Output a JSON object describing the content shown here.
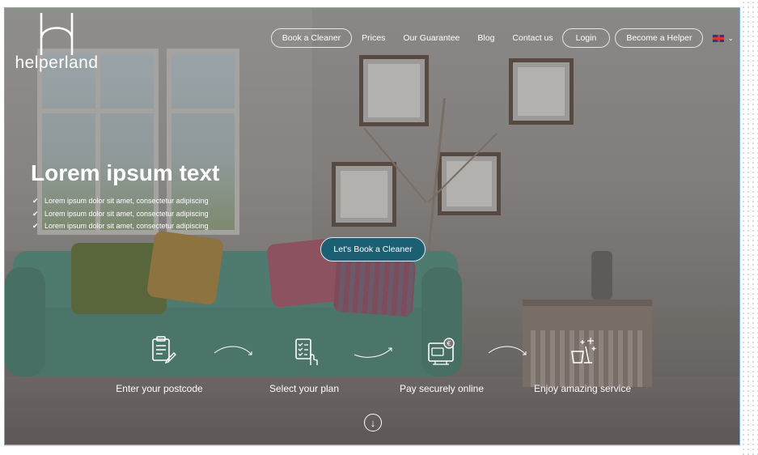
{
  "brand": {
    "name": "helperland"
  },
  "nav": {
    "book": "Book a Cleaner",
    "prices": "Prices",
    "guarantee": "Our Guarantee",
    "blog": "Blog",
    "contact": "Contact us",
    "login": "Login",
    "become": "Become a Helper",
    "language_icon": "uk-flag-icon"
  },
  "hero": {
    "headline": "Lorem ipsum text",
    "bullets": [
      "Lorem ipsum dolor sit amet, consectetur adipiscing",
      "Lorem ipsum dolor sit amet, consectetur adipiscing",
      "Lorem ipsum dolor sit amet, consectetur adipiscing"
    ],
    "cta": "Let's Book a Cleaner"
  },
  "steps": [
    {
      "label": "Enter your postcode",
      "icon": "clipboard-pencil-icon"
    },
    {
      "label": "Select your plan",
      "icon": "checklist-hand-icon"
    },
    {
      "label": "Pay securely online",
      "icon": "card-payment-icon"
    },
    {
      "label": "Enjoy amazing service",
      "icon": "bucket-sparkle-icon"
    }
  ],
  "colors": {
    "cta": "#1c5f73",
    "text": "#ffffff"
  }
}
